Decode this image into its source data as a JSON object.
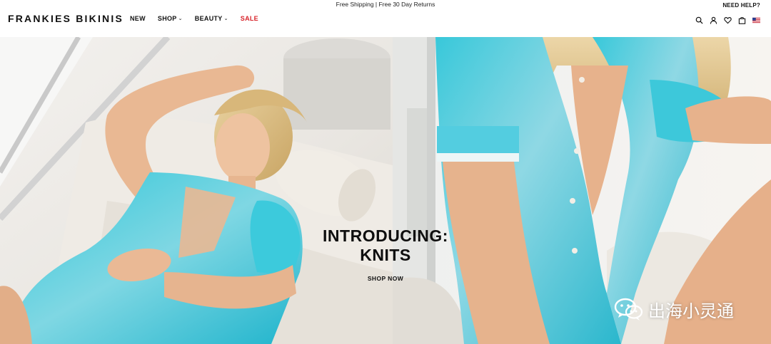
{
  "announcement": "Free Shipping | Free 30 Day Returns",
  "need_help": "NEED HELP?",
  "brand": "FRANKIES BIKINIS",
  "nav": [
    {
      "label": "NEW",
      "dropdown": false
    },
    {
      "label": "SHOP",
      "dropdown": true
    },
    {
      "label": "BEAUTY",
      "dropdown": true
    },
    {
      "label": "SALE",
      "dropdown": false,
      "color": "#d8232a"
    }
  ],
  "header_icons": [
    "search-icon",
    "account-icon",
    "wishlist-heart-icon",
    "cart-bag-icon",
    "us-flag-icon"
  ],
  "hero": {
    "title_line1": "INTRODUCING:",
    "title_line2": "KNITS",
    "cta": "SHOP NOW"
  },
  "watermark_text": "出海小灵通",
  "colors": {
    "accent_sale": "#d8232a",
    "knit_turquoise": "#2fc6d9",
    "text": "#111111"
  }
}
